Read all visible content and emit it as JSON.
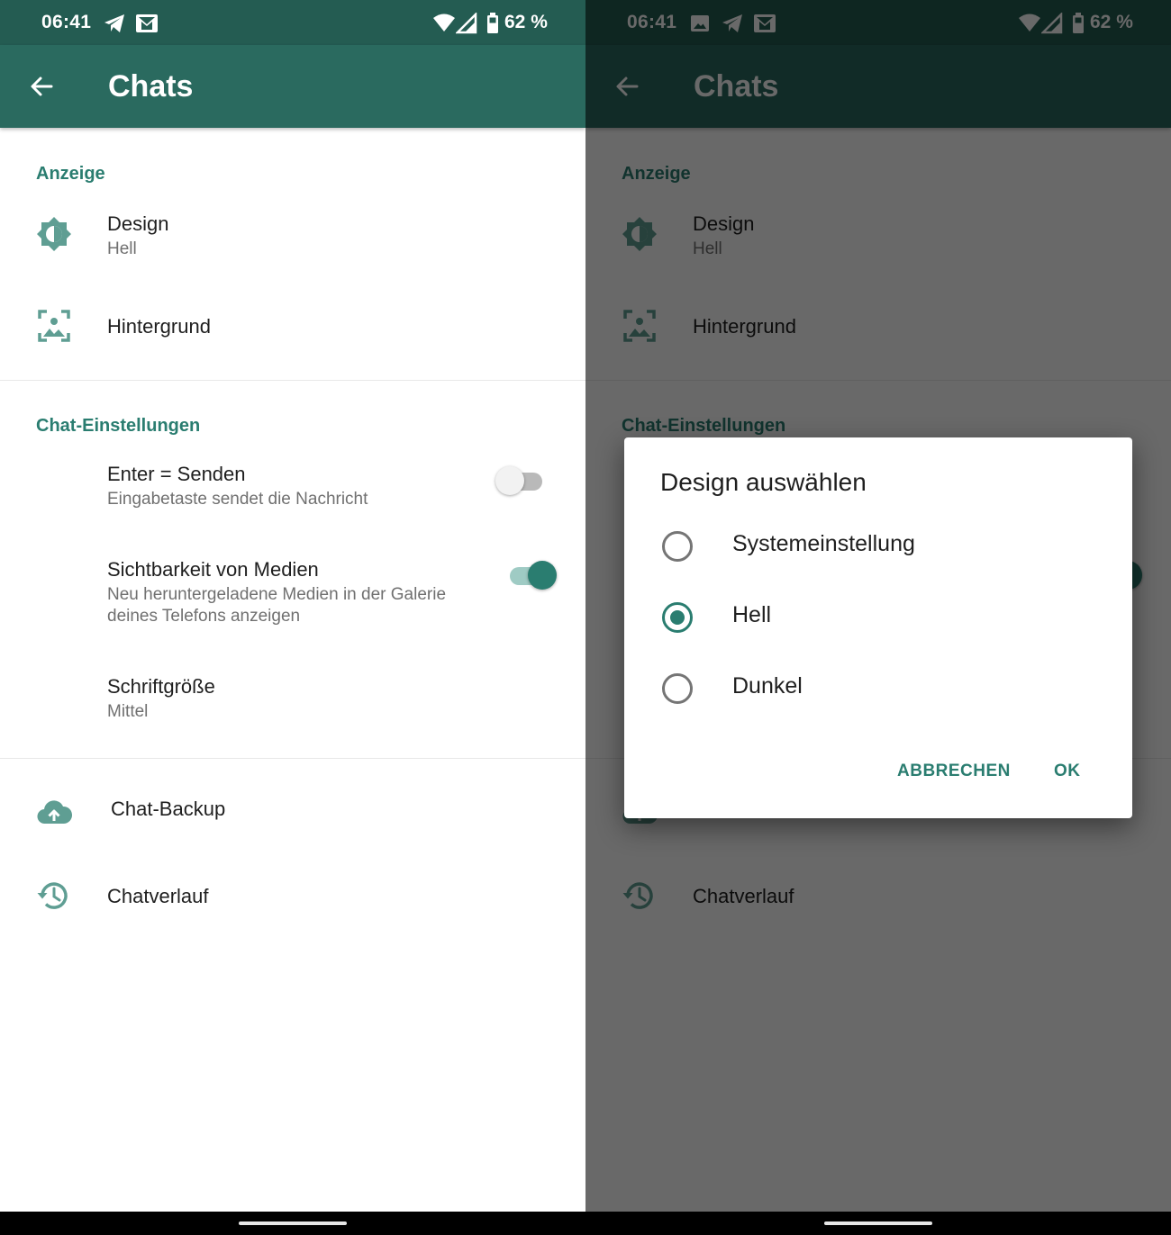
{
  "colors": {
    "statusbar": "#245c52",
    "appbar": "#2a6a5f",
    "accent": "#2a7d70",
    "scrim": "#000000"
  },
  "status_bar": {
    "time": "06:41",
    "battery": "62 %",
    "left_icons": [
      "telegram-icon",
      "gmail-icon"
    ],
    "right_left_icons": [
      "image-icon",
      "telegram-icon",
      "gmail-icon"
    ],
    "right_icons": [
      "wifi-icon",
      "cell-signal-icon",
      "battery-icon"
    ]
  },
  "app_bar": {
    "title": "Chats",
    "back_icon": "arrow-back-icon"
  },
  "sections": {
    "display": {
      "header": "Anzeige",
      "design": {
        "title": "Design",
        "value": "Hell",
        "icon": "brightness-icon"
      },
      "background": {
        "title": "Hintergrund",
        "icon": "wallpaper-icon"
      }
    },
    "chat_settings": {
      "header": "Chat-Einstellungen",
      "enter_send": {
        "title": "Enter = Senden",
        "subtitle": "Eingabetaste sendet die Nachricht",
        "enabled": false
      },
      "media_visibility": {
        "title": "Sichtbarkeit von Medien",
        "subtitle_line1": "Neu heruntergeladene Medien in der Galerie",
        "subtitle_line2": "deines Telefons anzeigen",
        "enabled": true
      },
      "font_size": {
        "title": "Schriftgröße",
        "value": "Mittel"
      }
    },
    "misc": {
      "backup": {
        "title": "Chat-Backup",
        "icon": "cloud-upload-icon"
      },
      "history": {
        "title": "Chatverlauf",
        "icon": "history-icon"
      }
    }
  },
  "dialog": {
    "title": "Design auswählen",
    "options": [
      {
        "label": "Systemeinstellung",
        "selected": false
      },
      {
        "label": "Hell",
        "selected": true
      },
      {
        "label": "Dunkel",
        "selected": false
      }
    ],
    "cancel_label": "ABBRECHEN",
    "ok_label": "OK"
  }
}
